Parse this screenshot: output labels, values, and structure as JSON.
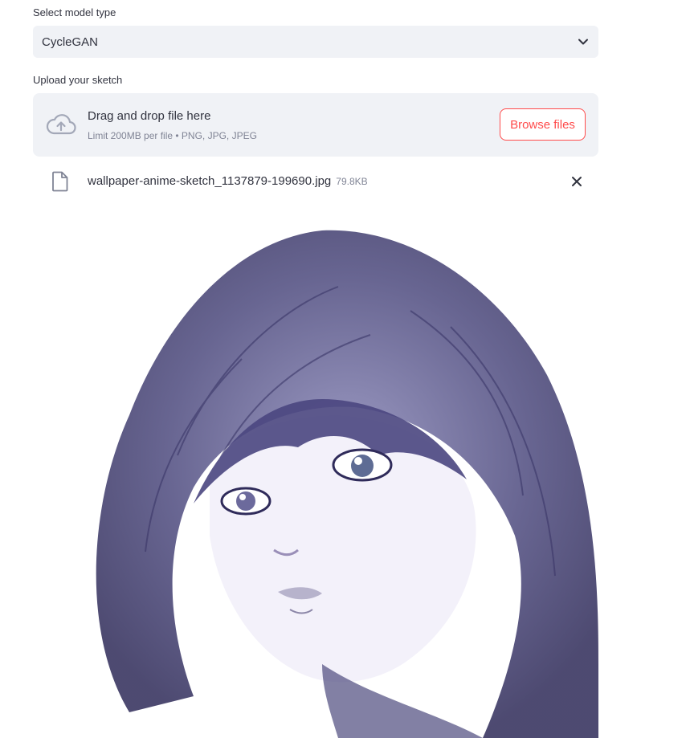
{
  "model_select": {
    "label": "Select model type",
    "value": "CycleGAN",
    "icon": "chevron-down-icon"
  },
  "uploader": {
    "label": "Upload your sketch",
    "drop_title": "Drag and drop file here",
    "limit_text": "Limit 200MB per file • PNG, JPG, JPEG",
    "browse_label": "Browse files",
    "icon": "cloud-upload-icon"
  },
  "uploaded_file": {
    "name": "wallpaper-anime-sketch_1137879-199690.jpg",
    "size": "79.8KB",
    "icon": "file-icon",
    "remove_icon": "close-icon"
  },
  "colors": {
    "accent": "#ff4b4b",
    "panel_bg": "#f0f2f6",
    "text": "#31333f",
    "muted_text": "#808495"
  }
}
